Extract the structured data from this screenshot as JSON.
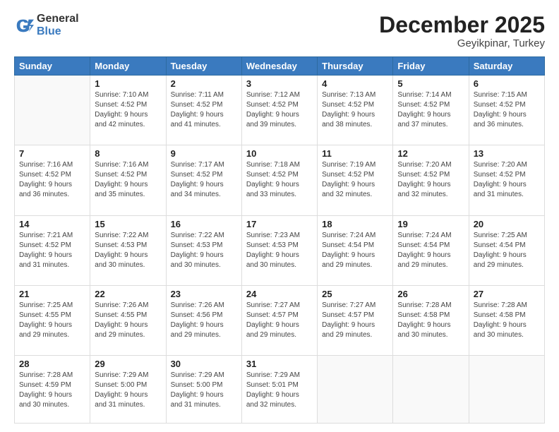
{
  "logo": {
    "general": "General",
    "blue": "Blue"
  },
  "header": {
    "month": "December 2025",
    "location": "Geyikpinar, Turkey"
  },
  "days_of_week": [
    "Sunday",
    "Monday",
    "Tuesday",
    "Wednesday",
    "Thursday",
    "Friday",
    "Saturday"
  ],
  "weeks": [
    [
      {
        "day": "",
        "info": ""
      },
      {
        "day": "1",
        "info": "Sunrise: 7:10 AM\nSunset: 4:52 PM\nDaylight: 9 hours\nand 42 minutes."
      },
      {
        "day": "2",
        "info": "Sunrise: 7:11 AM\nSunset: 4:52 PM\nDaylight: 9 hours\nand 41 minutes."
      },
      {
        "day": "3",
        "info": "Sunrise: 7:12 AM\nSunset: 4:52 PM\nDaylight: 9 hours\nand 39 minutes."
      },
      {
        "day": "4",
        "info": "Sunrise: 7:13 AM\nSunset: 4:52 PM\nDaylight: 9 hours\nand 38 minutes."
      },
      {
        "day": "5",
        "info": "Sunrise: 7:14 AM\nSunset: 4:52 PM\nDaylight: 9 hours\nand 37 minutes."
      },
      {
        "day": "6",
        "info": "Sunrise: 7:15 AM\nSunset: 4:52 PM\nDaylight: 9 hours\nand 36 minutes."
      }
    ],
    [
      {
        "day": "7",
        "info": "Sunrise: 7:16 AM\nSunset: 4:52 PM\nDaylight: 9 hours\nand 36 minutes."
      },
      {
        "day": "8",
        "info": "Sunrise: 7:16 AM\nSunset: 4:52 PM\nDaylight: 9 hours\nand 35 minutes."
      },
      {
        "day": "9",
        "info": "Sunrise: 7:17 AM\nSunset: 4:52 PM\nDaylight: 9 hours\nand 34 minutes."
      },
      {
        "day": "10",
        "info": "Sunrise: 7:18 AM\nSunset: 4:52 PM\nDaylight: 9 hours\nand 33 minutes."
      },
      {
        "day": "11",
        "info": "Sunrise: 7:19 AM\nSunset: 4:52 PM\nDaylight: 9 hours\nand 32 minutes."
      },
      {
        "day": "12",
        "info": "Sunrise: 7:20 AM\nSunset: 4:52 PM\nDaylight: 9 hours\nand 32 minutes."
      },
      {
        "day": "13",
        "info": "Sunrise: 7:20 AM\nSunset: 4:52 PM\nDaylight: 9 hours\nand 31 minutes."
      }
    ],
    [
      {
        "day": "14",
        "info": "Sunrise: 7:21 AM\nSunset: 4:52 PM\nDaylight: 9 hours\nand 31 minutes."
      },
      {
        "day": "15",
        "info": "Sunrise: 7:22 AM\nSunset: 4:53 PM\nDaylight: 9 hours\nand 30 minutes."
      },
      {
        "day": "16",
        "info": "Sunrise: 7:22 AM\nSunset: 4:53 PM\nDaylight: 9 hours\nand 30 minutes."
      },
      {
        "day": "17",
        "info": "Sunrise: 7:23 AM\nSunset: 4:53 PM\nDaylight: 9 hours\nand 30 minutes."
      },
      {
        "day": "18",
        "info": "Sunrise: 7:24 AM\nSunset: 4:54 PM\nDaylight: 9 hours\nand 29 minutes."
      },
      {
        "day": "19",
        "info": "Sunrise: 7:24 AM\nSunset: 4:54 PM\nDaylight: 9 hours\nand 29 minutes."
      },
      {
        "day": "20",
        "info": "Sunrise: 7:25 AM\nSunset: 4:54 PM\nDaylight: 9 hours\nand 29 minutes."
      }
    ],
    [
      {
        "day": "21",
        "info": "Sunrise: 7:25 AM\nSunset: 4:55 PM\nDaylight: 9 hours\nand 29 minutes."
      },
      {
        "day": "22",
        "info": "Sunrise: 7:26 AM\nSunset: 4:55 PM\nDaylight: 9 hours\nand 29 minutes."
      },
      {
        "day": "23",
        "info": "Sunrise: 7:26 AM\nSunset: 4:56 PM\nDaylight: 9 hours\nand 29 minutes."
      },
      {
        "day": "24",
        "info": "Sunrise: 7:27 AM\nSunset: 4:57 PM\nDaylight: 9 hours\nand 29 minutes."
      },
      {
        "day": "25",
        "info": "Sunrise: 7:27 AM\nSunset: 4:57 PM\nDaylight: 9 hours\nand 29 minutes."
      },
      {
        "day": "26",
        "info": "Sunrise: 7:28 AM\nSunset: 4:58 PM\nDaylight: 9 hours\nand 30 minutes."
      },
      {
        "day": "27",
        "info": "Sunrise: 7:28 AM\nSunset: 4:58 PM\nDaylight: 9 hours\nand 30 minutes."
      }
    ],
    [
      {
        "day": "28",
        "info": "Sunrise: 7:28 AM\nSunset: 4:59 PM\nDaylight: 9 hours\nand 30 minutes."
      },
      {
        "day": "29",
        "info": "Sunrise: 7:29 AM\nSunset: 5:00 PM\nDaylight: 9 hours\nand 31 minutes."
      },
      {
        "day": "30",
        "info": "Sunrise: 7:29 AM\nSunset: 5:00 PM\nDaylight: 9 hours\nand 31 minutes."
      },
      {
        "day": "31",
        "info": "Sunrise: 7:29 AM\nSunset: 5:01 PM\nDaylight: 9 hours\nand 32 minutes."
      },
      {
        "day": "",
        "info": ""
      },
      {
        "day": "",
        "info": ""
      },
      {
        "day": "",
        "info": ""
      }
    ]
  ]
}
